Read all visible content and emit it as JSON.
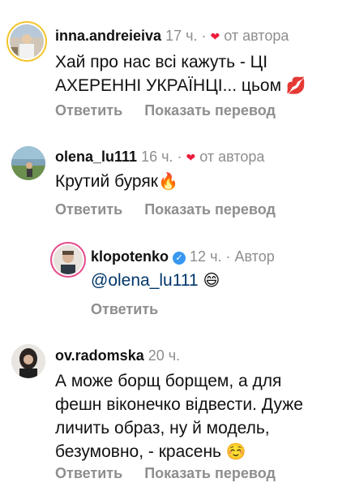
{
  "comments": [
    {
      "username": "inna.andreieiva",
      "time": "17 ч.",
      "sep": "·",
      "heart": "❤",
      "by_author": "от автора",
      "text1": "Хай про нас всі кажуть - ЦІ",
      "text2": "АХЕРЕННІ УКРАЇНЦІ... цьом",
      "emoji": "💋",
      "reply": "Ответить",
      "translate": "Показать перевод"
    },
    {
      "username": "olena_lu111",
      "time": "16 ч.",
      "sep": "·",
      "heart": "❤",
      "by_author": "от автора",
      "text1": "Крутий буряк",
      "emoji": "🔥",
      "reply": "Ответить",
      "translate": "Показать перевод"
    },
    {
      "username": "klopotenko",
      "verified": "✓",
      "time": "12 ч.",
      "sep": "·",
      "role": "Автор",
      "mention": "@olena_lu111",
      "emoji": "😄",
      "reply": "Ответить"
    },
    {
      "username": "ov.radomska",
      "time": "20 ч.",
      "text1": "А може борщ борщем, а для",
      "text2": "фешн віконечко відвести. Дуже",
      "text3": "личить образ, ну й модель,",
      "text4": "безумовно, - красень",
      "emoji": "☺️",
      "reply": "Ответить",
      "translate": "Показать перевод"
    }
  ]
}
